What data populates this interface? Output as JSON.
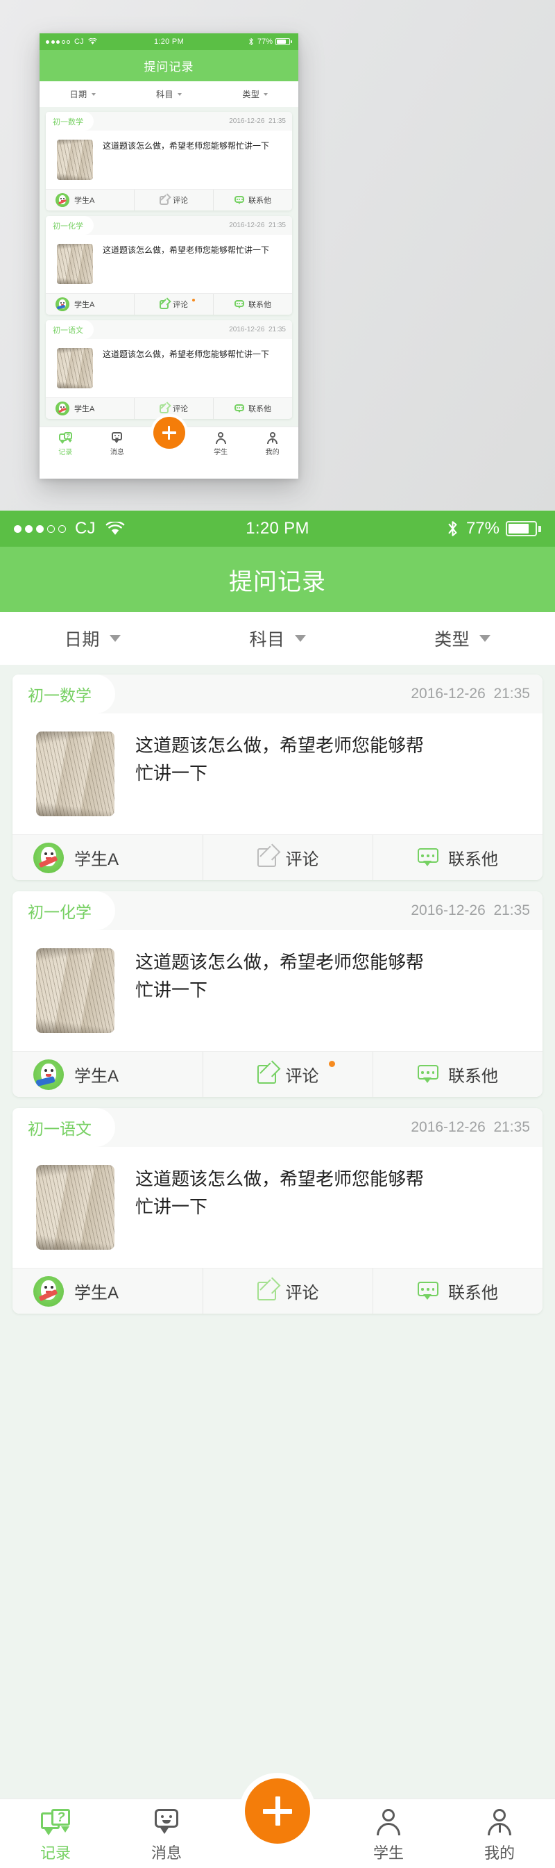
{
  "meta": {
    "app_title": "提问记录"
  },
  "status_bar": {
    "signal_dots_filled": 3,
    "signal_dots_hollow": 2,
    "carrier": "CJ",
    "wifi_icon": "wifi-icon",
    "time": "1:20 PM",
    "bluetooth_icon": "bluetooth-icon",
    "battery_percent": "77%",
    "battery_level": 77,
    "bar_color": "#5bbf45"
  },
  "nav_bar": {
    "title": "提问记录",
    "color": "#76d163"
  },
  "filter_bar": {
    "items": [
      {
        "label": "日期",
        "icon": "chevron-down-icon"
      },
      {
        "label": "科目",
        "icon": "chevron-down-icon"
      },
      {
        "label": "类型",
        "icon": "chevron-down-icon"
      }
    ]
  },
  "cards": [
    {
      "subject_tag": "初一数学",
      "date": "2016-12-26",
      "time": "21:35",
      "question": "这道题该怎么做，希望老师您能够帮忙讲一下",
      "thumbnail": "handwritten-notebook-photo",
      "actions": {
        "student": {
          "label": "学生A",
          "avatar": "student-avatar-scarf"
        },
        "comment": {
          "label": "评论",
          "icon": "pencil-edit-icon",
          "state": "inactive",
          "has_badge": false
        },
        "contact": {
          "label": "联系他",
          "icon": "chat-bubble-icon",
          "state": "active"
        }
      }
    },
    {
      "subject_tag": "初一化学",
      "date": "2016-12-26",
      "time": "21:35",
      "question": "这道题该怎么做，希望老师您能够帮忙讲一下",
      "thumbnail": "handwritten-notebook-photo",
      "actions": {
        "student": {
          "label": "学生A",
          "avatar": "student-avatar-book"
        },
        "comment": {
          "label": "评论",
          "icon": "pencil-edit-icon",
          "state": "active",
          "has_badge": true
        },
        "contact": {
          "label": "联系他",
          "icon": "chat-bubble-icon",
          "state": "active"
        }
      }
    },
    {
      "subject_tag": "初一语文",
      "date": "2016-12-26",
      "time": "21:35",
      "question": "这道题该怎么做，希望老师您能够帮忙讲一下",
      "thumbnail": "handwritten-notebook-photo",
      "actions": {
        "student": {
          "label": "学生A",
          "avatar": "student-avatar-scarf"
        },
        "comment": {
          "label": "评论",
          "icon": "pencil-edit-icon",
          "state": "inactive",
          "has_badge": false
        },
        "contact": {
          "label": "联系他",
          "icon": "chat-bubble-icon",
          "state": "active"
        }
      }
    }
  ],
  "tab_bar": {
    "tabs": [
      {
        "label": "记录",
        "icon": "records-question-icon",
        "active": true
      },
      {
        "label": "消息",
        "icon": "message-smiley-icon",
        "active": false
      },
      {
        "label": "学生",
        "icon": "person-icon",
        "active": false
      },
      {
        "label": "我的",
        "icon": "profile-icon",
        "active": false
      }
    ],
    "fab": {
      "icon": "plus-icon",
      "color": "#f47d0a"
    },
    "active_color": "#76d163",
    "inactive_color": "#5a5a5a"
  }
}
